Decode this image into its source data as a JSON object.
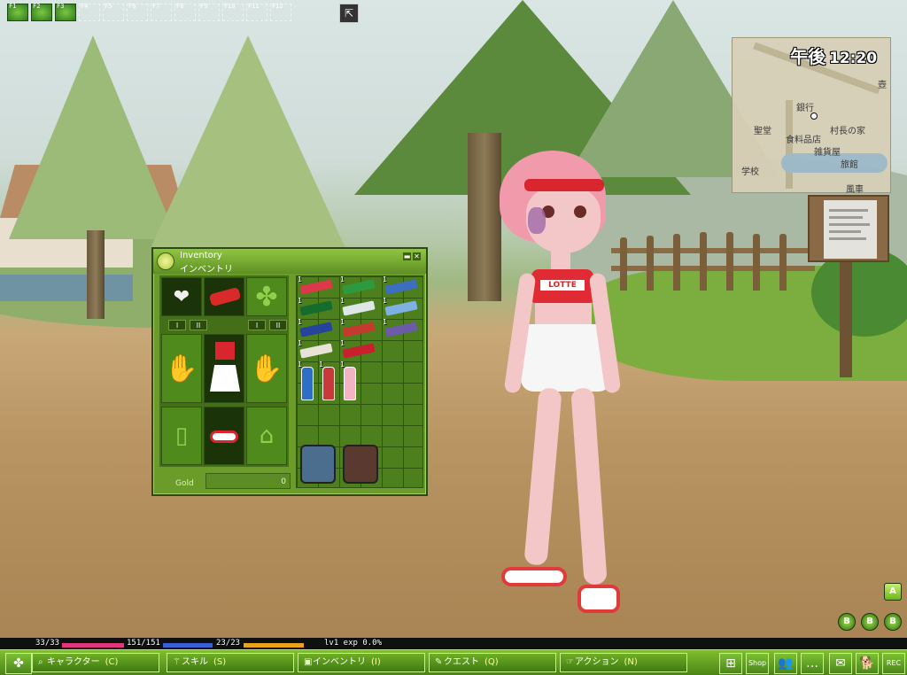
{
  "hotkeys": {
    "slots": [
      {
        "key": "F1",
        "filled": true
      },
      {
        "key": "F2",
        "filled": true
      },
      {
        "key": "F3",
        "filled": true
      },
      {
        "key": "F4",
        "filled": false
      },
      {
        "key": "F5",
        "filled": false
      },
      {
        "key": "F6",
        "filled": false
      },
      {
        "key": "F7",
        "filled": false
      },
      {
        "key": "F8",
        "filled": false
      },
      {
        "key": "F9",
        "filled": false
      },
      {
        "key": "F10",
        "filled": false
      },
      {
        "key": "F11",
        "filled": false
      },
      {
        "key": "F12",
        "filled": false
      }
    ],
    "special_icon": "cursor-mode-icon"
  },
  "clock": {
    "ampm": "午後",
    "time": "12:20"
  },
  "minimap": {
    "labels": [
      "壺",
      "銀行",
      "聖堂",
      "村長の家",
      "食料品店",
      "雑貨屋",
      "学校",
      "旅館",
      "風車"
    ]
  },
  "inventory": {
    "title": "Inventory",
    "title_jp": "インベントリ",
    "tab_labels": [
      "I",
      "II",
      "I",
      "II"
    ],
    "gold_label": "Gold",
    "gold_value": "0",
    "items": [
      {
        "name": "gum-pack-red",
        "qty": "1",
        "color": "#d83a4a"
      },
      {
        "name": "gum-pack-green",
        "qty": "1",
        "color": "#2e9a3f"
      },
      {
        "name": "gum-pack-blue",
        "qty": "1",
        "color": "#3d6fbe"
      },
      {
        "name": "gum-pack-dark-green",
        "qty": "1",
        "color": "#146d2d"
      },
      {
        "name": "gum-pack-white",
        "qty": "1",
        "color": "#dfe6e8"
      },
      {
        "name": "gum-pack-sky",
        "qty": "1",
        "color": "#7fb0e2"
      },
      {
        "name": "snack-box-navy",
        "qty": "1",
        "color": "#27449c"
      },
      {
        "name": "chocolate-box",
        "qty": "1",
        "color": "#c53a2e"
      },
      {
        "name": "snack-box-purple",
        "qty": "1",
        "color": "#6c5ca8"
      },
      {
        "name": "cookie-box",
        "qty": "1",
        "color": "#e7e3d6"
      },
      {
        "name": "candy-box-red",
        "qty": "1",
        "color": "#c8202e"
      },
      {
        "name": "drink-bottle-blue",
        "qty": "1",
        "color": "#2e6fc5"
      },
      {
        "name": "drink-bottle-red",
        "qty": "1",
        "color": "#c9383a"
      },
      {
        "name": "drink-bottle-pink",
        "qty": "1",
        "color": "#f2b4c4"
      }
    ]
  },
  "status": {
    "hp": "33/33",
    "hp_fill": 1.0,
    "mp": "151/151",
    "mp_fill": 1.0,
    "sp": "23/23",
    "sp_fill": 1.0,
    "level_exp": "lv1  exp 0.0%",
    "colors": {
      "hp": "#e0377a",
      "mp": "#3a5fd6",
      "sp": "#e8a21d"
    }
  },
  "taskbar": {
    "menu_icon": "clover-menu-icon",
    "buttons": [
      {
        "label": "キャラクター",
        "key": "(C)",
        "icon": "search-icon"
      },
      {
        "label": "スキル",
        "key": "(S)",
        "icon": "wand-icon"
      },
      {
        "label": "インベントリ",
        "key": "(I)",
        "icon": "bag-icon"
      },
      {
        "label": "クエスト",
        "key": "(Q)",
        "icon": "quest-icon"
      },
      {
        "label": "アクション",
        "key": "(N)",
        "icon": "action-icon"
      }
    ],
    "tray": [
      {
        "icon": "map-icon",
        "text": "⊞"
      },
      {
        "icon": "shop-icon",
        "text": "Shop"
      },
      {
        "icon": "party-icon",
        "text": "👥"
      },
      {
        "icon": "chat-icon",
        "text": "…"
      },
      {
        "icon": "mail-icon",
        "text": "✉"
      },
      {
        "icon": "pet-icon",
        "text": "🐕"
      },
      {
        "icon": "rec-icon",
        "text": "REC"
      }
    ]
  },
  "hud": {
    "bubbles": [
      "B",
      "B",
      "B"
    ],
    "corner_icon": "A"
  },
  "colors": {
    "ui_green": "#6b9c29",
    "ui_dark_green": "#2e4a10"
  }
}
